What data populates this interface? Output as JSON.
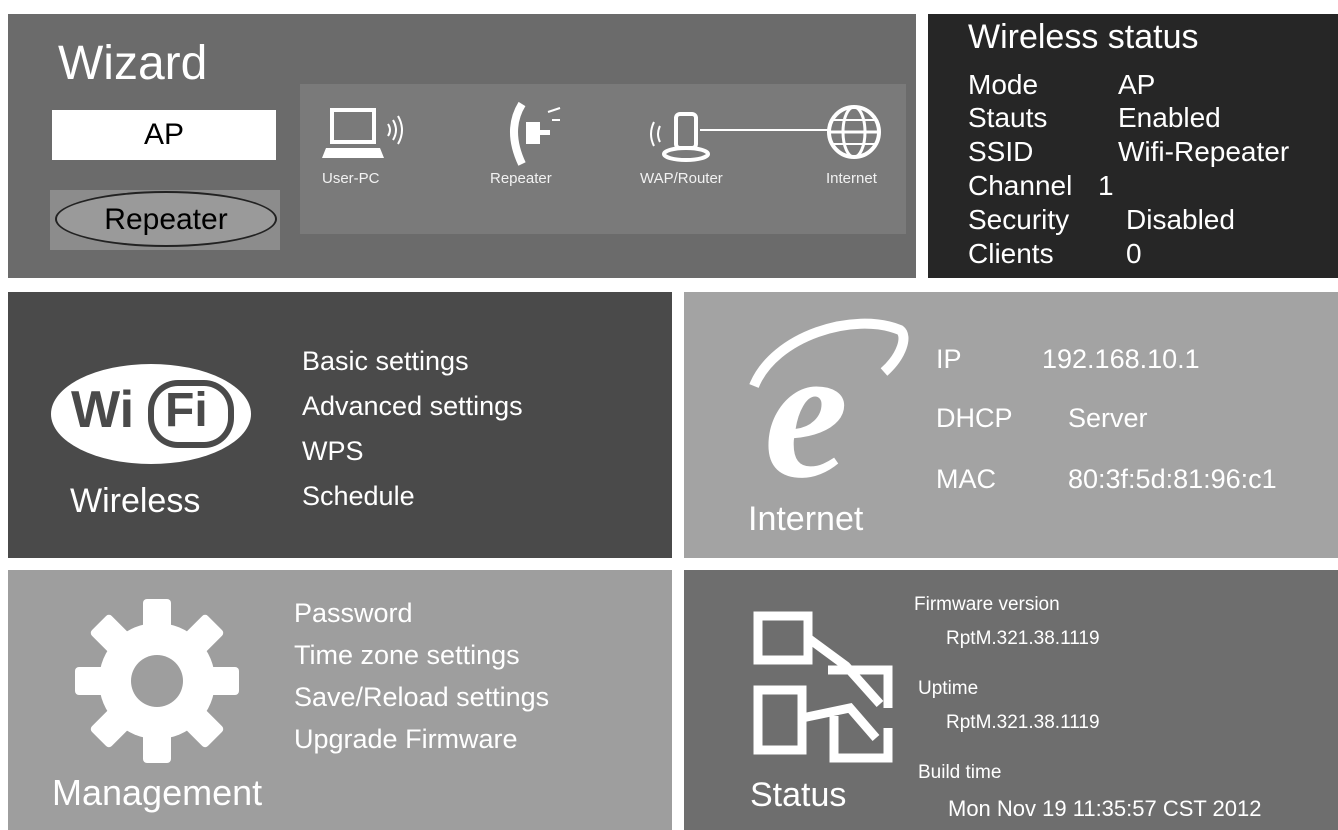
{
  "wizard": {
    "title": "Wizard",
    "ap_button": "AP",
    "repeater_button": "Repeater",
    "diagram_labels": {
      "user_pc": "User-PC",
      "repeater": "Repeater",
      "router": "WAP/Router",
      "internet": "Internet"
    }
  },
  "wireless_status": {
    "title": "Wireless status",
    "rows": [
      {
        "key": "Mode",
        "value": "AP"
      },
      {
        "key": "Stauts",
        "value": "Enabled"
      },
      {
        "key": "SSID",
        "value": "Wifi-Repeater"
      },
      {
        "key": "Channel",
        "value": "1"
      },
      {
        "key": "Security",
        "value": "Disabled"
      },
      {
        "key": "Clients",
        "value": "0"
      }
    ]
  },
  "wireless": {
    "title": "Wireless",
    "logo_wi": "Wi",
    "logo_fi": "Fi",
    "menu": [
      "Basic settings",
      "Advanced settings",
      "WPS",
      "Schedule"
    ]
  },
  "internet": {
    "title": "Internet",
    "rows": [
      {
        "key": "IP",
        "value": "192.168.10.1"
      },
      {
        "key": "DHCP",
        "value": "Server"
      },
      {
        "key": "MAC",
        "value": "80:3f:5d:81:96:c1"
      }
    ]
  },
  "management": {
    "title": "Management",
    "menu": [
      "Password",
      "Time zone settings",
      "Save/Reload settings",
      "Upgrade Firmware"
    ]
  },
  "status": {
    "title": "Status",
    "firmware_label": "Firmware version",
    "firmware_value": "RptM.321.38.1119",
    "uptime_label": "Uptime",
    "uptime_value": "RptM.321.38.1119",
    "build_label": "Build time",
    "build_value": "Mon Nov 19 11:35:57 CST 2012"
  }
}
